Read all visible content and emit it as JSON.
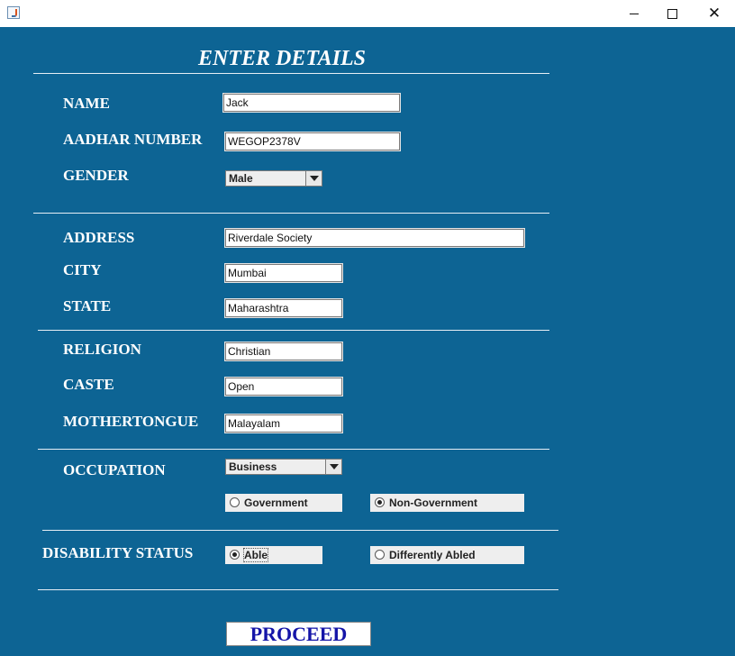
{
  "window": {
    "icon": "java-cup-icon",
    "controls": [
      "minimize",
      "maximize",
      "close"
    ]
  },
  "form": {
    "heading": "ENTER DETAILS",
    "name": {
      "label": "NAME",
      "value": "Jack"
    },
    "aadhar": {
      "label": "AADHAR NUMBER",
      "value": "WEGOP2378V"
    },
    "gender": {
      "label": "GENDER",
      "selected": "Male"
    },
    "address": {
      "label": "ADDRESS",
      "value": "Riverdale Society"
    },
    "city": {
      "label": "CITY",
      "value": "Mumbai"
    },
    "state": {
      "label": "STATE",
      "value": "Maharashtra"
    },
    "religion": {
      "label": "RELIGION",
      "value": "Christian"
    },
    "caste": {
      "label": "CASTE",
      "value": "Open"
    },
    "mothertongue": {
      "label": "MOTHERTONGUE",
      "value": "Malayalam"
    },
    "occupation": {
      "label": "OCCUPATION",
      "selected": "Business",
      "options": [
        {
          "label": "Government",
          "checked": false
        },
        {
          "label": "Non-Government",
          "checked": true
        }
      ]
    },
    "disability": {
      "label": "DISABILITY STATUS",
      "options": [
        {
          "label": "Able",
          "checked": true
        },
        {
          "label": "Differently Abled",
          "checked": false
        }
      ]
    },
    "proceed_label": "PROCEED"
  },
  "colors": {
    "background": "#0d6494",
    "label_text": "#ffffff",
    "button_text": "#1515a8"
  }
}
